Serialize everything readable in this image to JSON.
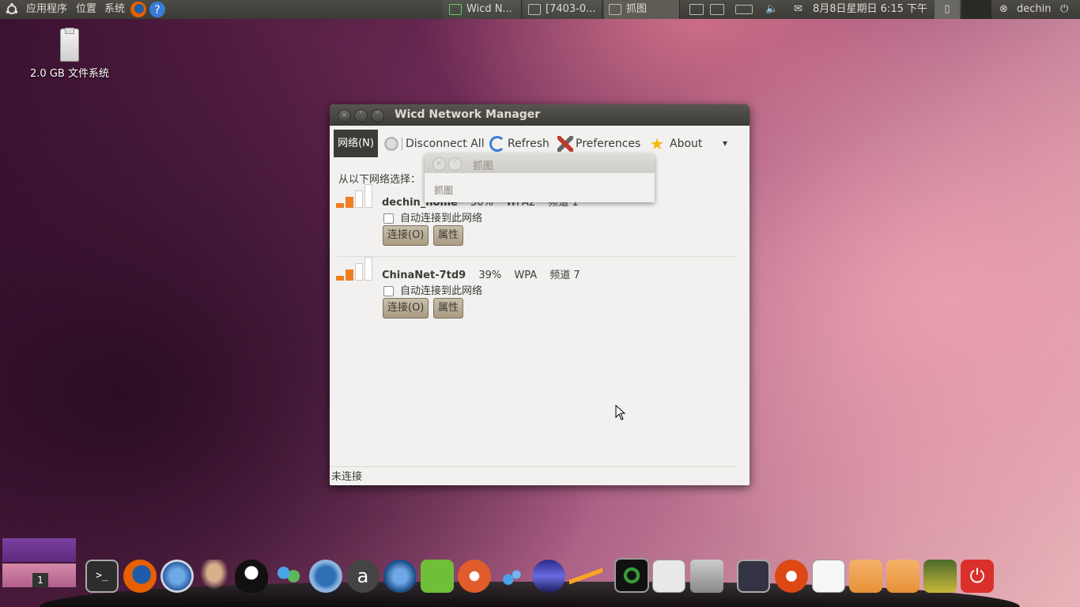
{
  "top_panel": {
    "menus": [
      "应用程序",
      "位置",
      "系统"
    ],
    "tasks": [
      {
        "label": "Wicd N...",
        "icon": "wicd-icon"
      },
      {
        "label": "[7403-0...",
        "icon": "image-viewer-icon"
      },
      {
        "label": "抓图",
        "icon": "camera-icon",
        "active": true
      }
    ],
    "clock": "8月8日星期日 6:15 下午",
    "user": "dechin"
  },
  "desktop": {
    "usb_label": "2.0 GB 文件系统"
  },
  "wicd": {
    "title": "Wicd Network Manager",
    "menu_network": "网络(N)",
    "toolbar": {
      "disconnect": "Disconnect All",
      "refresh": "Refresh",
      "preferences": "Preferences",
      "about": "About",
      "more": "▾"
    },
    "choose_label": "从以下网络选择：",
    "networks": [
      {
        "ssid": "dechin_home",
        "strength": "50%",
        "security": "WPA2",
        "channel": "频道 1",
        "auto": "自动连接到此网络",
        "connect": "连接(O)",
        "props": "属性",
        "bars": 2
      },
      {
        "ssid": "ChinaNet-7td9",
        "strength": "39%",
        "security": "WPA",
        "channel": "频道 7",
        "auto": "自动连接到此网络",
        "connect": "连接(O)",
        "props": "属性",
        "bars": 2
      }
    ],
    "status": "未连接"
  },
  "grab_window": {
    "title": "抓图",
    "body": "抓图"
  },
  "workspace": {
    "number": "1"
  },
  "colors": {
    "panel": "#3c3b37",
    "signal": "#f07e21",
    "button": "#b8ab94"
  }
}
